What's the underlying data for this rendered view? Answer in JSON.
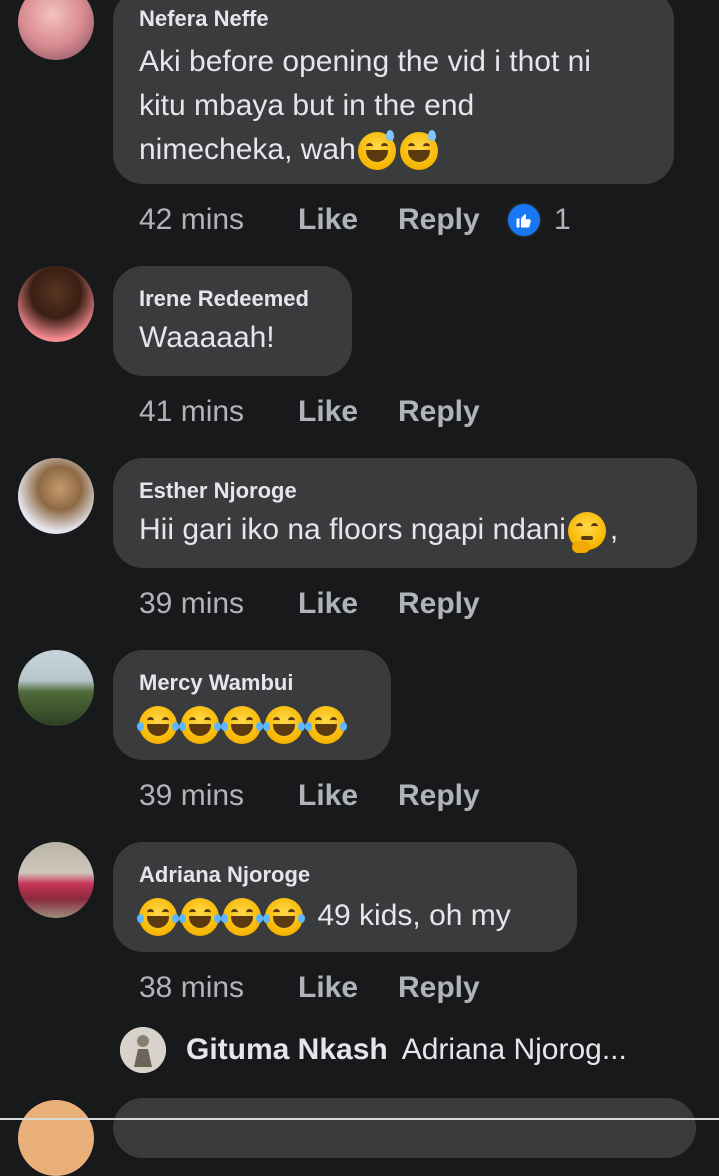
{
  "comments": [
    {
      "author": "Nefera Neffe",
      "lines": [
        "Aki before opening the vid i thot ni",
        "kitu mbaya but in the end",
        "nimecheka, wah"
      ],
      "emojis_end": [
        "sweat-smile",
        "sweat-smile"
      ],
      "time": "42 mins",
      "like": "Like",
      "reply": "Reply",
      "reaction_count": "1"
    },
    {
      "author": "Irene Redeemed",
      "lines": [
        "Waaaaah!"
      ],
      "time": "41 mins",
      "like": "Like",
      "reply": "Reply"
    },
    {
      "author": "Esther Njoroge",
      "lines": [
        "Hii gari iko na floors ngapi ndani"
      ],
      "after_emoji": ",",
      "emojis_end": [
        "thinking"
      ],
      "time": "39 mins",
      "like": "Like",
      "reply": "Reply"
    },
    {
      "author": "Mercy Wambui",
      "emojis_only": [
        "rolling-laughing",
        "rolling-laughing",
        "rolling-laughing",
        "rolling-laughing",
        "rolling-laughing"
      ],
      "time": "39 mins",
      "like": "Like",
      "reply": "Reply"
    },
    {
      "author": "Adriana Njoroge",
      "emojis_prefix": [
        "rolling-laughing",
        "rolling-laughing",
        "rolling-laughing",
        "rolling-laughing"
      ],
      "text_after": "49 kids, oh my",
      "time": "38 mins",
      "like": "Like",
      "reply": "Reply"
    }
  ],
  "reply_preview": {
    "name": "Gituma Nkash",
    "snippet": "Adriana Njorog..."
  },
  "colors": {
    "background": "#18191a",
    "bubble": "#3a3b3c",
    "primary_text": "#e4e6eb",
    "secondary_text": "#b0b3b8",
    "like_blue": "#1877f2"
  }
}
